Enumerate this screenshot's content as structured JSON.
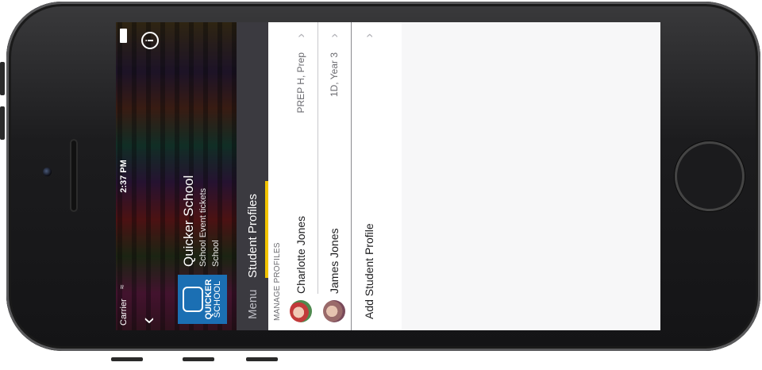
{
  "status": {
    "carrier": "Carrier",
    "time": "2:37 PM"
  },
  "hero": {
    "logo_line1": "QUICKER",
    "logo_line2": "SCHOOL",
    "title": "Quicker School",
    "subtitle": "School Event tickets",
    "category": "School"
  },
  "icons": {
    "back": "back-chevron-icon",
    "info": "info-icon",
    "battery": "battery-icon",
    "wifi": "wifi-icon"
  },
  "tabs": [
    {
      "label": "Menu"
    },
    {
      "label": "Student Profiles"
    }
  ],
  "section_title": "MANAGE PROFILES",
  "profiles": [
    {
      "name": "Charlotte  Jones",
      "meta": "PREP H, Prep"
    },
    {
      "name": "James Jones",
      "meta": "1D, Year 3"
    }
  ],
  "add_label": "Add Student Profile",
  "colors": {
    "accent": "#f2c400",
    "tabbar": "#3b3a40",
    "logo": "#1b6fb3"
  }
}
